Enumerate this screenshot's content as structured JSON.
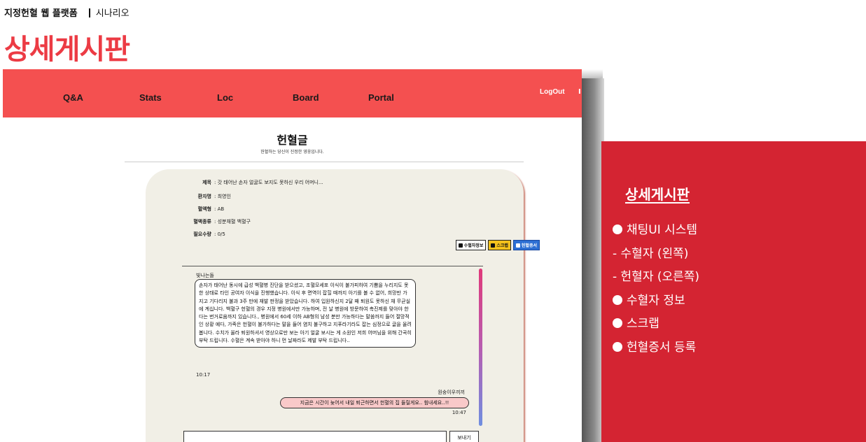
{
  "header": {
    "project": "지정헌혈 웹 플랫폼",
    "subtitle": "시나리오",
    "title": "상세게시판"
  },
  "nav": {
    "items": [
      "Q&A",
      "Stats",
      "Loc",
      "Board",
      "Portal"
    ],
    "logout": "LogOut",
    "edge": "I"
  },
  "section": {
    "title": "헌혈글",
    "subtitle": "헌혈하는 당신이 진정한 영웅입니다."
  },
  "post": {
    "fields": [
      {
        "label": "제목",
        "value": "갓 태어난 손자 얼굴도 보지도 못하신 우리 어머니..."
      },
      {
        "label": "환자명",
        "value": "최영인"
      },
      {
        "label": "혈액형",
        "value": "AB"
      },
      {
        "label": "혈액종류",
        "value": "성분채혈 백혈구"
      },
      {
        "label": "필요수량",
        "value": "0/5"
      }
    ],
    "buttons": {
      "recipient_info": "수혈자정보",
      "scrap": "스크랩",
      "certificate": "헌혈증서"
    }
  },
  "chat": {
    "left_sender": "빛나는돌",
    "left_message": "손자가 태어난 동시에 급성 백혈병 진단을 받으셨고, 조혈모세포 이식이 불가피하여 기쁨을 누리지도 못한 상태로 타인 공여자 이식을 진행했습니다. 이식 후 면역이 잡힐 때까지 아기를 볼 수 없어, 희망만 가지고 기다리지 불과 3주 만에 재발 판정을 받았습니다. 하여 입원하신지 2달 째 퇴원도 못하신 채 무균실에 계십니다. 백혈구 헌혈의 경우 지정 병원에서만 가능하며, 전 날 병원에 방문하여 촉진제를 맞아야 한다는 번거로움까지 있습니다., 병원에서 60세 이하 AB형의 남성 분만 가능하다는 말씀까지 들어 절망적인 상황 예다, 가족은 헌혈이 불가하다는 말을 들어 염치 불구하고 지푸라기라도 잡는 심정으로 글을 올려봅니다. 수치가 올라 퇴원하셔서 영상으로만 보는 아기 얼굴 보시는 게 소원인 저희 어머님을 위해 간곡히 부탁 드립니다. 수혈은 계속 받아야 하니 먼 날짜라도 제발 부탁 드립니다..",
    "left_time": "10:17",
    "right_sender": "원숭이우끼끼",
    "right_message": "지금은 시간이 늦어서 내일 퇴근하면서 헌혈의 집 들릴게요.. 힘내세요..!!",
    "right_time": "10:47",
    "send_label": "보내기"
  },
  "panel": {
    "title": "상세게시판",
    "items": [
      {
        "bullet": true,
        "text": "채팅UI 시스템"
      },
      {
        "bullet": false,
        "text": "- 수혈자 (왼쪽)"
      },
      {
        "bullet": false,
        "text": "- 헌혈자 (오른쪽)"
      },
      {
        "bullet": true,
        "text": "수혈자 정보"
      },
      {
        "bullet": true,
        "text": "스크랩"
      },
      {
        "bullet": true,
        "text": "헌혈증서 등록"
      }
    ]
  },
  "colors": {
    "accent_title": "#ec3b44",
    "navbar": "#f45050",
    "panel": "#d42432"
  }
}
